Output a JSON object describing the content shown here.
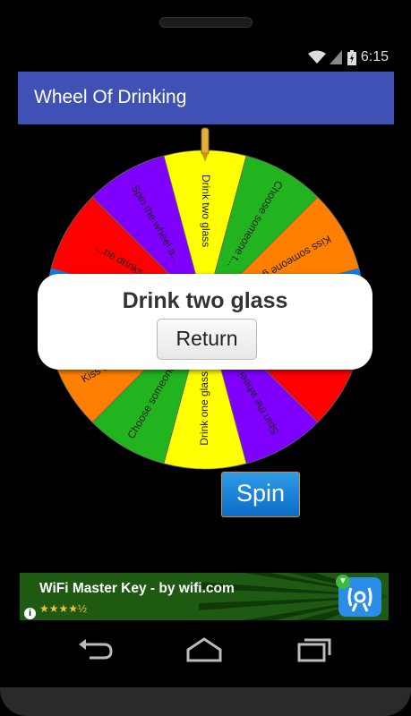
{
  "status_bar": {
    "time": "6:15",
    "icons": [
      "wifi-icon",
      "signal-icon",
      "battery-icon"
    ]
  },
  "app": {
    "title": "Wheel Of Drinking",
    "accent_color": "#3f51b5"
  },
  "wheel": {
    "segments": [
      {
        "label": "Drink two glass",
        "color": "#ffff00"
      },
      {
        "label": "Choose someone t...",
        "color": "#22b41f"
      },
      {
        "label": "Kiss someone gir...",
        "color": "#ff7f00"
      },
      {
        "label": "...",
        "color": "#007fff"
      },
      {
        "label": "",
        "color": "#ff0000"
      },
      {
        "label": "Spin the wheel a...",
        "color": "#7f00ff"
      },
      {
        "label": "Drink one glass",
        "color": "#ffff00"
      },
      {
        "label": "Choose someone t...",
        "color": "#22b41f"
      },
      {
        "label": "Kiss someone g...",
        "color": "#ff7f00"
      },
      {
        "label": "",
        "color": "#007fff"
      },
      {
        "label": "...ne drinks",
        "color": "#ff0000"
      },
      {
        "label": "Spin the wheel a...",
        "color": "#7f00ff"
      }
    ]
  },
  "result": {
    "text": "Drink two glass",
    "return_label": "Return"
  },
  "spin_label": "Spin",
  "ad": {
    "title": "WiFi Master Key - by wifi.com",
    "rating_stars": "★★★★½",
    "rating": 4.5,
    "info_glyph": "i",
    "install_glyph": "▼"
  }
}
